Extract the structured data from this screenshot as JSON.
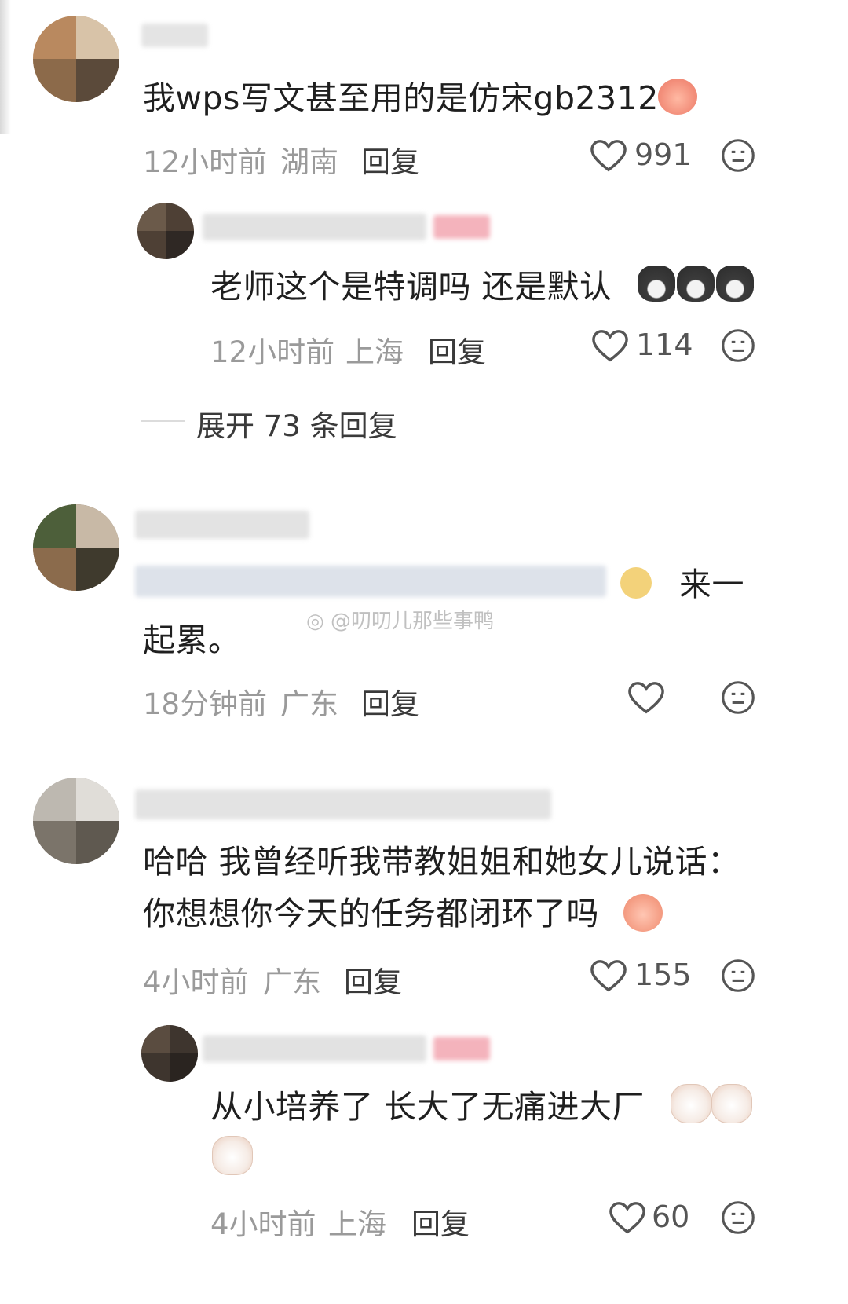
{
  "comments": [
    {
      "text": "我wps写文甚至用的是仿宋gb2312",
      "time": "12小时前",
      "location": "湖南",
      "reply_label": "回复",
      "likes": "991",
      "reply": {
        "text": "老师这个是特调吗  还是默认",
        "time": "12小时前",
        "location": "上海",
        "reply_label": "回复",
        "likes": "114"
      },
      "expand_label": "展开 73 条回复"
    },
    {
      "text_tail": "来一",
      "text_line2": "起累。",
      "time": "18分钟前",
      "location": "广东",
      "reply_label": "回复",
      "likes": ""
    },
    {
      "text_line1": "哈哈  我曾经听我带教姐姐和她女儿说话：",
      "text_line2": "你想想你今天的任务都闭环了吗",
      "time": "4小时前",
      "location": "广东",
      "reply_label": "回复",
      "likes": "155",
      "reply": {
        "text_line1": "从小培养了  长大了无痛进大厂",
        "time": "4小时前",
        "location": "上海",
        "reply_label": "回复",
        "likes": "60"
      }
    }
  ],
  "watermark": "@叨叨儿那些事鸭",
  "colors": {
    "meta": "#9a9a9a",
    "icon": "#555555",
    "background": "#ffffff"
  }
}
